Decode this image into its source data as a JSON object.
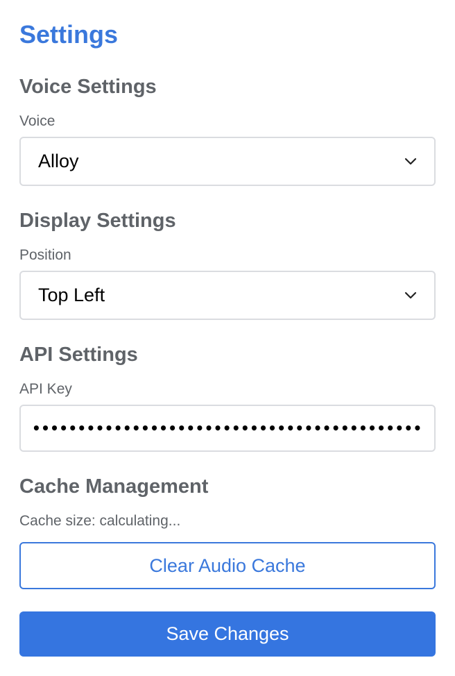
{
  "page": {
    "title": "Settings"
  },
  "voice_settings": {
    "section_title": "Voice Settings",
    "voice_label": "Voice",
    "voice_value": "Alloy"
  },
  "display_settings": {
    "section_title": "Display Settings",
    "position_label": "Position",
    "position_value": "Top Left"
  },
  "api_settings": {
    "section_title": "API Settings",
    "api_key_label": "API Key",
    "api_key_masked": "••••••••••••••••••••••••••••••••••••••••••••••••••••••••••••••"
  },
  "cache_management": {
    "section_title": "Cache Management",
    "cache_size_text": "Cache size: calculating...",
    "clear_button_label": "Clear Audio Cache"
  },
  "actions": {
    "save_button_label": "Save Changes"
  },
  "colors": {
    "accent": "#3a78dc",
    "primary_button": "#3575e0",
    "text_muted": "#5f6368",
    "border": "#dadce0"
  },
  "icons": {
    "select_arrow": "chevron-down-icon"
  }
}
